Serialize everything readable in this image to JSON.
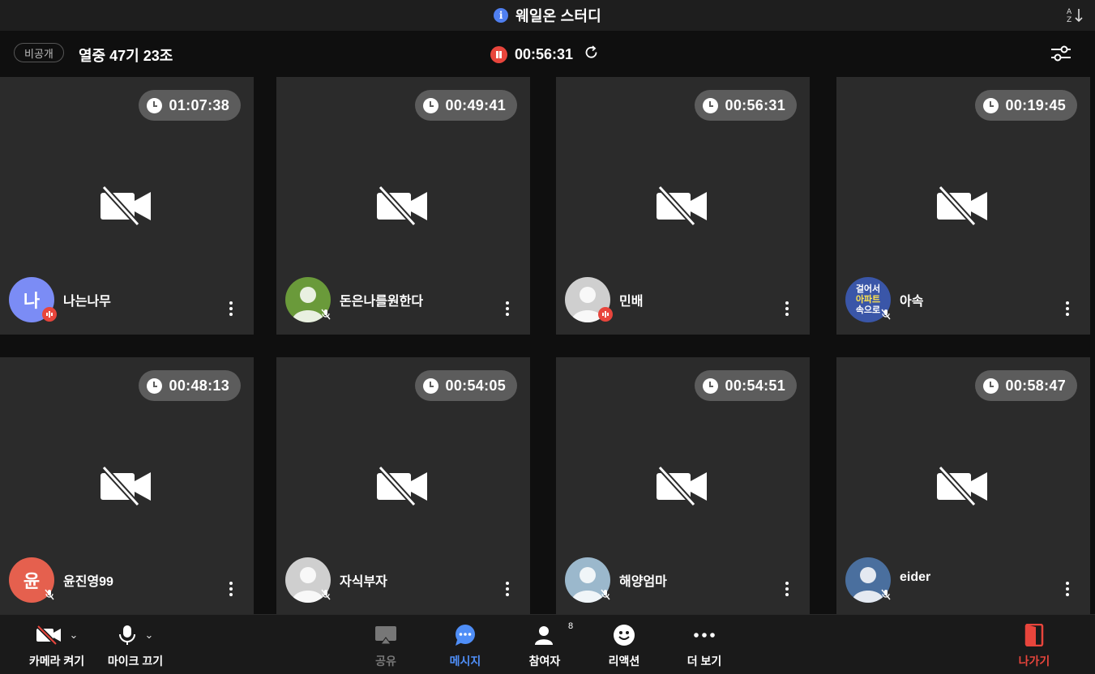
{
  "header": {
    "title": "웨일온 스터디",
    "info_icon": "i",
    "sort_icon": "sort-az-icon"
  },
  "subbar": {
    "visibility": "비공개",
    "room_name": "열중 47기 23조",
    "session_time": "00:56:31"
  },
  "participants": [
    {
      "name": "나는나무",
      "time": "01:07:38",
      "avatar_text": "나",
      "avatar_color": "#7b8cf5",
      "mic": "active"
    },
    {
      "name": "돈은나를원한다",
      "time": "00:49:41",
      "avatar_text": "",
      "avatar_color": "#6a9a3a",
      "mic": "muted"
    },
    {
      "name": "민배",
      "time": "00:56:31",
      "avatar_text": "",
      "avatar_color": "#cfcfcf",
      "mic": "active"
    },
    {
      "name": "아속",
      "time": "00:19:45",
      "avatar_text": "",
      "avatar_color": "#3a56a8",
      "mic": "muted"
    },
    {
      "name": "윤진영99",
      "time": "00:48:13",
      "avatar_text": "윤",
      "avatar_color": "#e5604e",
      "mic": "muted"
    },
    {
      "name": "자식부자",
      "time": "00:54:05",
      "avatar_text": "",
      "avatar_color": "#cfcfcf",
      "mic": "muted"
    },
    {
      "name": "해양엄마",
      "time": "00:54:51",
      "avatar_text": "",
      "avatar_color": "#9bb8cc",
      "mic": "muted"
    },
    {
      "name": "eider",
      "time": "00:58:47",
      "avatar_text": "",
      "avatar_color": "#4a6f9e",
      "mic": "muted"
    }
  ],
  "avatar4_text": [
    "걸어서",
    "아파트",
    "속으로"
  ],
  "toolbar": {
    "camera": "카메라 켜기",
    "mic": "마이크 끄기",
    "share": "공유",
    "message": "메시지",
    "participants": "참여자",
    "participant_count": "8",
    "reaction": "리액션",
    "more": "더 보기",
    "leave": "나가기"
  },
  "colors": {
    "accent_blue": "#4f8ef7",
    "leave_red": "#e8453c",
    "tile_bg": "#2b2b2b"
  }
}
